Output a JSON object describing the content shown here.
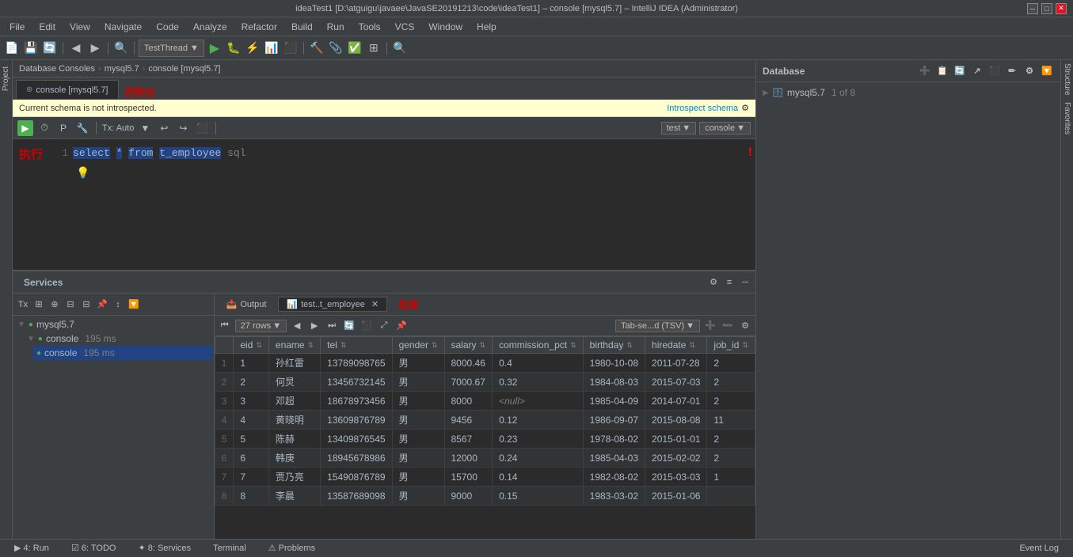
{
  "titleBar": {
    "title": "ideaTest1 [D:\\atguigu\\javaee\\JavaSE20191213\\code\\ideaTest1] – console [mysql5.7] – IntelliJ IDEA (Administrator)",
    "minBtn": "─",
    "maxBtn": "□",
    "closeBtn": "✕"
  },
  "menuBar": {
    "items": [
      "File",
      "Edit",
      "View",
      "Navigate",
      "Code",
      "Analyze",
      "Refactor",
      "Build",
      "Run",
      "Tools",
      "VCS",
      "Window",
      "Help"
    ]
  },
  "breadcrumb": {
    "items": [
      "Database Consoles",
      "mysql5.7",
      "console [mysql5.7]"
    ]
  },
  "consoleTab": {
    "label": "console [mysql5.7]",
    "annotation": "控制台"
  },
  "warningBar": {
    "message": "Current schema is not introspected.",
    "actionLabel": "Introspect schema",
    "gearIcon": "⚙"
  },
  "consoleTx": {
    "label": "Tx: Auto"
  },
  "contextBadges": {
    "test": "test",
    "console": "console"
  },
  "sql": {
    "lineNum": "1",
    "keyword1": "select",
    "operator": "*",
    "keyword2": "from",
    "tableName": "t_employee",
    "annotation": "sql",
    "executionLabel": "执行"
  },
  "rightPanel": {
    "title": "Database",
    "treeItem": "mysql5.7",
    "treeItemInfo": "1 of 8"
  },
  "bottomPanel": {
    "title": "Services",
    "tabs": [
      "Tx",
      "",
      "",
      "",
      "",
      "",
      ""
    ],
    "treeItems": [
      {
        "label": "mysql5.7",
        "indent": 0,
        "hasArrow": true
      },
      {
        "label": "console  195 ms",
        "indent": 1,
        "hasArrow": true,
        "green": true
      },
      {
        "label": "console  195 ms",
        "indent": 2,
        "selected": true,
        "green": true
      }
    ]
  },
  "resultsPanel": {
    "outputTab": "Output",
    "tableTab": "test..t_employee",
    "closeIcon": "✕",
    "resultLabel": "结果",
    "rowsLabel": "27 rows",
    "exportLabel": "Tab-se...d (TSV)"
  },
  "tableHeaders": [
    "eid",
    "ename",
    "tel",
    "gender",
    "salary",
    "commission_pct",
    "birthday",
    "hiredate",
    "job_id"
  ],
  "tableRows": [
    {
      "rowNum": "1",
      "eid": "1",
      "ename": "孙红雷",
      "tel": "13789098765",
      "gender": "男",
      "salary": "8000.46",
      "commission_pct": "0.4",
      "birthday": "1980-10-08",
      "hiredate": "2011-07-28",
      "job_id": "2"
    },
    {
      "rowNum": "2",
      "eid": "2",
      "ename": "何炅",
      "tel": "13456732145",
      "gender": "男",
      "salary": "7000.67",
      "commission_pct": "0.32",
      "birthday": "1984-08-03",
      "hiredate": "2015-07-03",
      "job_id": "2"
    },
    {
      "rowNum": "3",
      "eid": "3",
      "ename": "邓超",
      "tel": "18678973456",
      "gender": "男",
      "salary": "8000",
      "commission_pct": "<null>",
      "birthday": "1985-04-09",
      "hiredate": "2014-07-01",
      "job_id": "2"
    },
    {
      "rowNum": "4",
      "eid": "4",
      "ename": "黄晓明",
      "tel": "13609876789",
      "gender": "男",
      "salary": "9456",
      "commission_pct": "0.12",
      "birthday": "1986-09-07",
      "hiredate": "2015-08-08",
      "job_id": "11"
    },
    {
      "rowNum": "5",
      "eid": "5",
      "ename": "陈赫",
      "tel": "13409876545",
      "gender": "男",
      "salary": "8567",
      "commission_pct": "0.23",
      "birthday": "1978-08-02",
      "hiredate": "2015-01-01",
      "job_id": "2"
    },
    {
      "rowNum": "6",
      "eid": "6",
      "ename": "韩庚",
      "tel": "18945678986",
      "gender": "男",
      "salary": "12000",
      "commission_pct": "0.24",
      "birthday": "1985-04-03",
      "hiredate": "2015-02-02",
      "job_id": "2"
    },
    {
      "rowNum": "7",
      "eid": "7",
      "ename": "贾乃亮",
      "tel": "15490876789",
      "gender": "男",
      "salary": "15700",
      "commission_pct": "0.14",
      "birthday": "1982-08-02",
      "hiredate": "2015-03-03",
      "job_id": "1"
    },
    {
      "rowNum": "8",
      "eid": "8",
      "ename": "李晨",
      "tel": "13587689098",
      "gender": "男",
      "salary": "9000",
      "commission_pct": "0.15",
      "birthday": "1983-03-02",
      "hiredate": "2015-01-06",
      "job_id": ""
    }
  ],
  "statusBar": {
    "run": "▶ 4: Run",
    "todo": "☑ 6: TODO",
    "services": "✦ 8: Services",
    "terminal": "Terminal",
    "problems": "⚠ Problems",
    "eventLog": "Event Log"
  }
}
